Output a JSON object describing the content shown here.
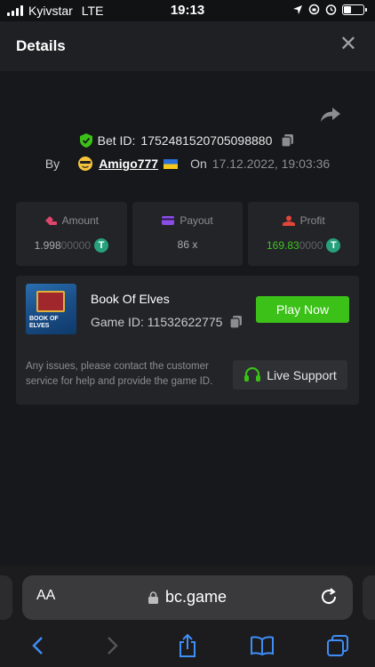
{
  "status_bar": {
    "carrier": "Kyivstar",
    "network": "LTE",
    "time": "19:13"
  },
  "header": {
    "title": "Details",
    "close_icon": "close-icon"
  },
  "bet": {
    "id_label": "Bet ID:",
    "id": "1752481520705098880"
  },
  "by_line": {
    "by": "By",
    "user": "Amigo777",
    "on": "On",
    "date": "17.12.2022, 19:03:36"
  },
  "stats": {
    "amount": {
      "label": "Amount",
      "value_main": "1.998",
      "value_dim": "00000"
    },
    "payout": {
      "label": "Payout",
      "value": "86 x"
    },
    "profit": {
      "label": "Profit",
      "value_main": "169.83",
      "value_dim": "0000"
    }
  },
  "currency_icon": "T",
  "game": {
    "name": "Book Of Elves",
    "id_label": "Game ID:",
    "id": "11532622775",
    "thumb_text": "BOOK OF ELVES",
    "play_label": "Play Now",
    "issue_text": "Any issues, please contact the customer service for help and provide the game ID.",
    "support_label": "Live Support"
  },
  "browser": {
    "aa": "AA",
    "domain": "bc.game"
  },
  "colors": {
    "accent_green": "#3bc117",
    "profit_green": "#3ec51e",
    "amount_pink": "#e0456b",
    "payout_purple": "#8a4ee6",
    "profit_red": "#e0453a"
  }
}
